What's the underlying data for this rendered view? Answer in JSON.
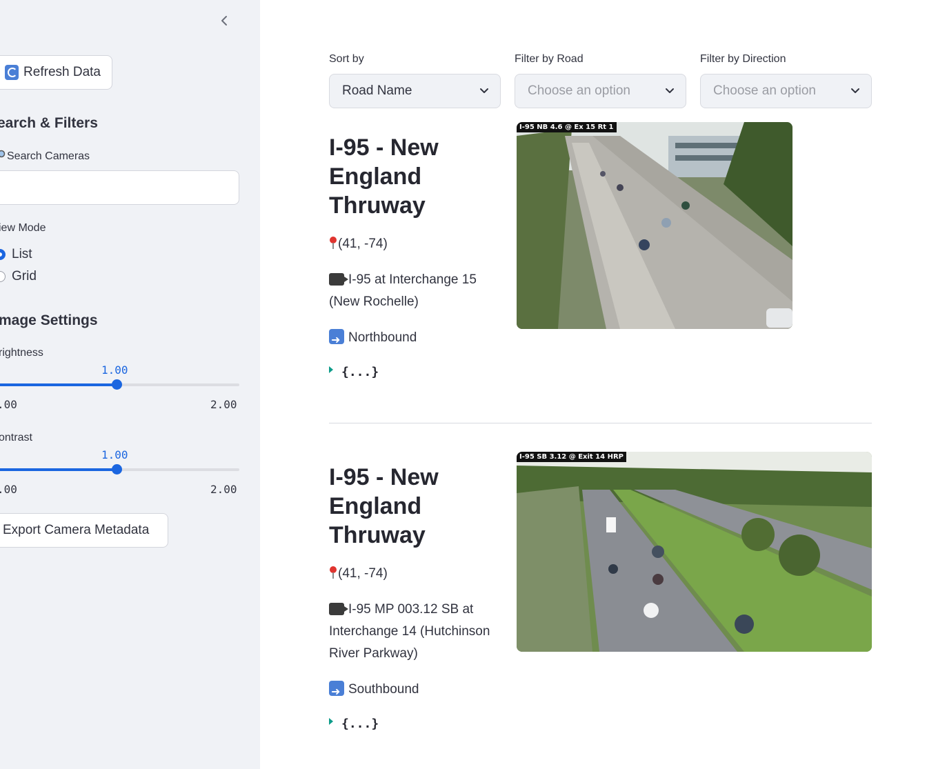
{
  "sidebar": {
    "refresh_label": "Refresh Data",
    "search_filters_heading": "earch & Filters",
    "search_label": "Search Cameras",
    "search_value": "",
    "view_mode_label": "iew Mode",
    "view_modes": [
      "List",
      "Grid"
    ],
    "view_mode_selected": "List",
    "image_settings_heading": "mage Settings",
    "brightness": {
      "label": "rightness",
      "value": "1.00",
      "min": ".00",
      "max": "2.00",
      "fraction": 0.5
    },
    "contrast": {
      "label": "ontrast",
      "value": "1.00",
      "min": ".00",
      "max": "2.00",
      "fraction": 0.5
    },
    "export_label": "Export Camera Metadata"
  },
  "filters": {
    "sort_label": "Sort by",
    "sort_value": "Road Name",
    "road_label": "Filter by Road",
    "road_placeholder": "Choose an option",
    "direction_label": "Filter by Direction",
    "direction_placeholder": "Choose an option"
  },
  "cameras": [
    {
      "title": "I-95 - New England Thruway",
      "coords": "(41, -74)",
      "description": "I-95 at Interchange 15 (New Rochelle)",
      "direction": "Northbound",
      "json_preview": "{...}",
      "image_tag": "I-95 NB 4.6 @ Ex 15 Rt 1"
    },
    {
      "title": "I-95 - New England Thruway",
      "coords": "(41, -74)",
      "description": "I-95 MP 003.12 SB at Interchange 14 (Hutchinson River Parkway)",
      "direction": "Southbound",
      "json_preview": "{...}",
      "image_tag": "I-95 SB 3.12 @ Exit 14 HRP"
    }
  ],
  "colors": {
    "accent": "#1b66e0",
    "sidebar_bg": "#f0f2f6"
  }
}
